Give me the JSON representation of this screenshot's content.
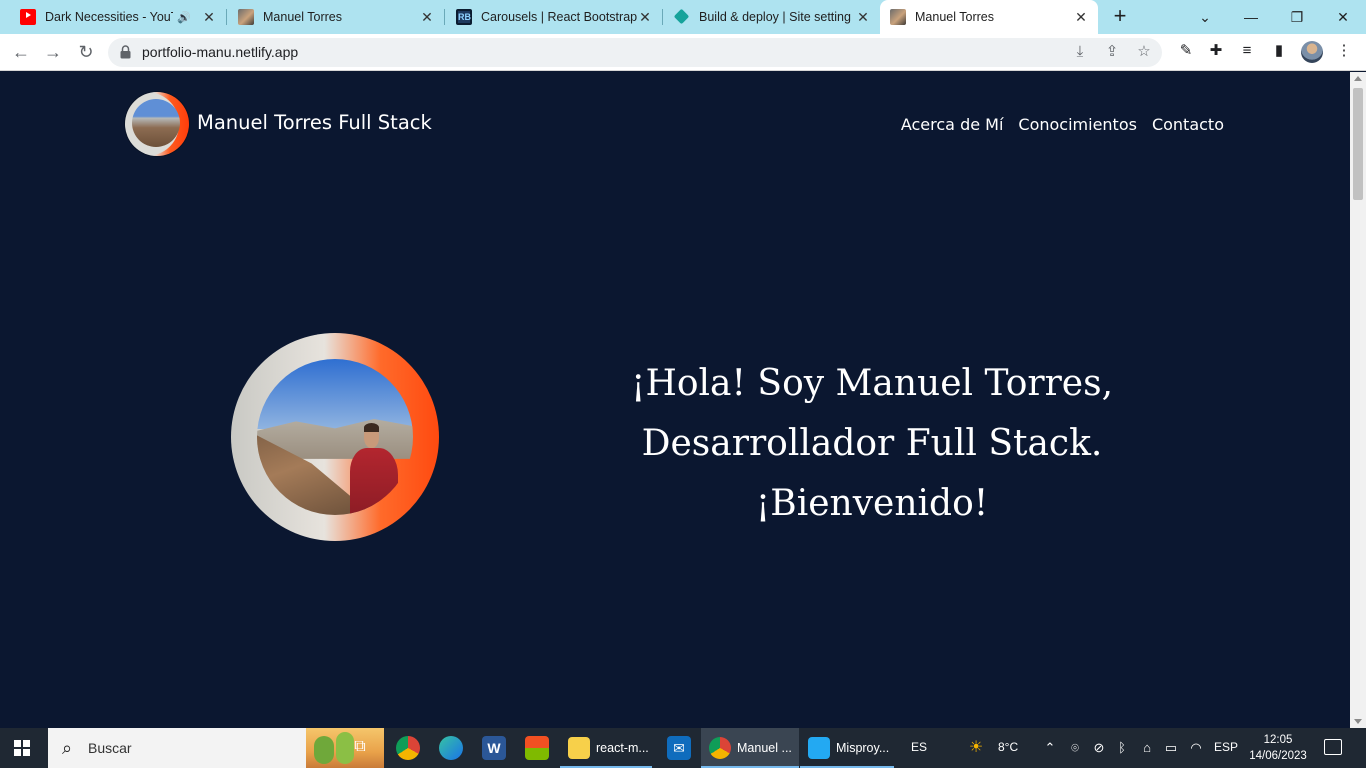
{
  "browser": {
    "tabs": [
      {
        "title": "Dark Necessities - YouTube",
        "favicon": "youtube-icon",
        "playing_audio": true,
        "active": false
      },
      {
        "title": "Manuel Torres",
        "favicon": "photo-favicon-icon",
        "active": false
      },
      {
        "title": "Carousels | React Bootstrap",
        "favicon": "react-bootstrap-icon",
        "active": false
      },
      {
        "title": "Build & deploy | Site settings",
        "favicon": "netlify-icon",
        "active": false
      },
      {
        "title": "Manuel Torres",
        "favicon": "photo-favicon-icon",
        "active": true
      }
    ],
    "new_tab_symbol": "+",
    "window_controls": {
      "minimize": "—",
      "restore": "❐",
      "close": "✕",
      "tab_search": "⌄"
    },
    "address": "portfolio-manu.netlify.app",
    "nav": {
      "back": "←",
      "forward": "→",
      "reload": "↻"
    }
  },
  "page": {
    "brand_name": "Manuel Torres Full Stack",
    "nav_links": [
      "Acerca de Mí",
      "Conocimientos",
      "Contacto"
    ],
    "hero_lines": [
      "¡Hola! Soy Manuel Torres,",
      "Desarrollador Full Stack.",
      "¡Bienvenido!"
    ],
    "colors": {
      "background": "#0b1730",
      "accent": "#ff5b1f",
      "text": "#ffffff"
    }
  },
  "taskbar": {
    "search_placeholder": "Buscar",
    "apps": [
      {
        "label": "react-m...",
        "icon": "file-explorer-icon"
      },
      {
        "label": "Manuel ...",
        "icon": "chrome-icon",
        "active": true
      },
      {
        "label": "Misproy...",
        "icon": "vscode-icon"
      }
    ],
    "input_language": "ES",
    "weather": "8°C",
    "keyboard_layout": "ESP",
    "time": "12:05",
    "date": "14/06/2023"
  }
}
